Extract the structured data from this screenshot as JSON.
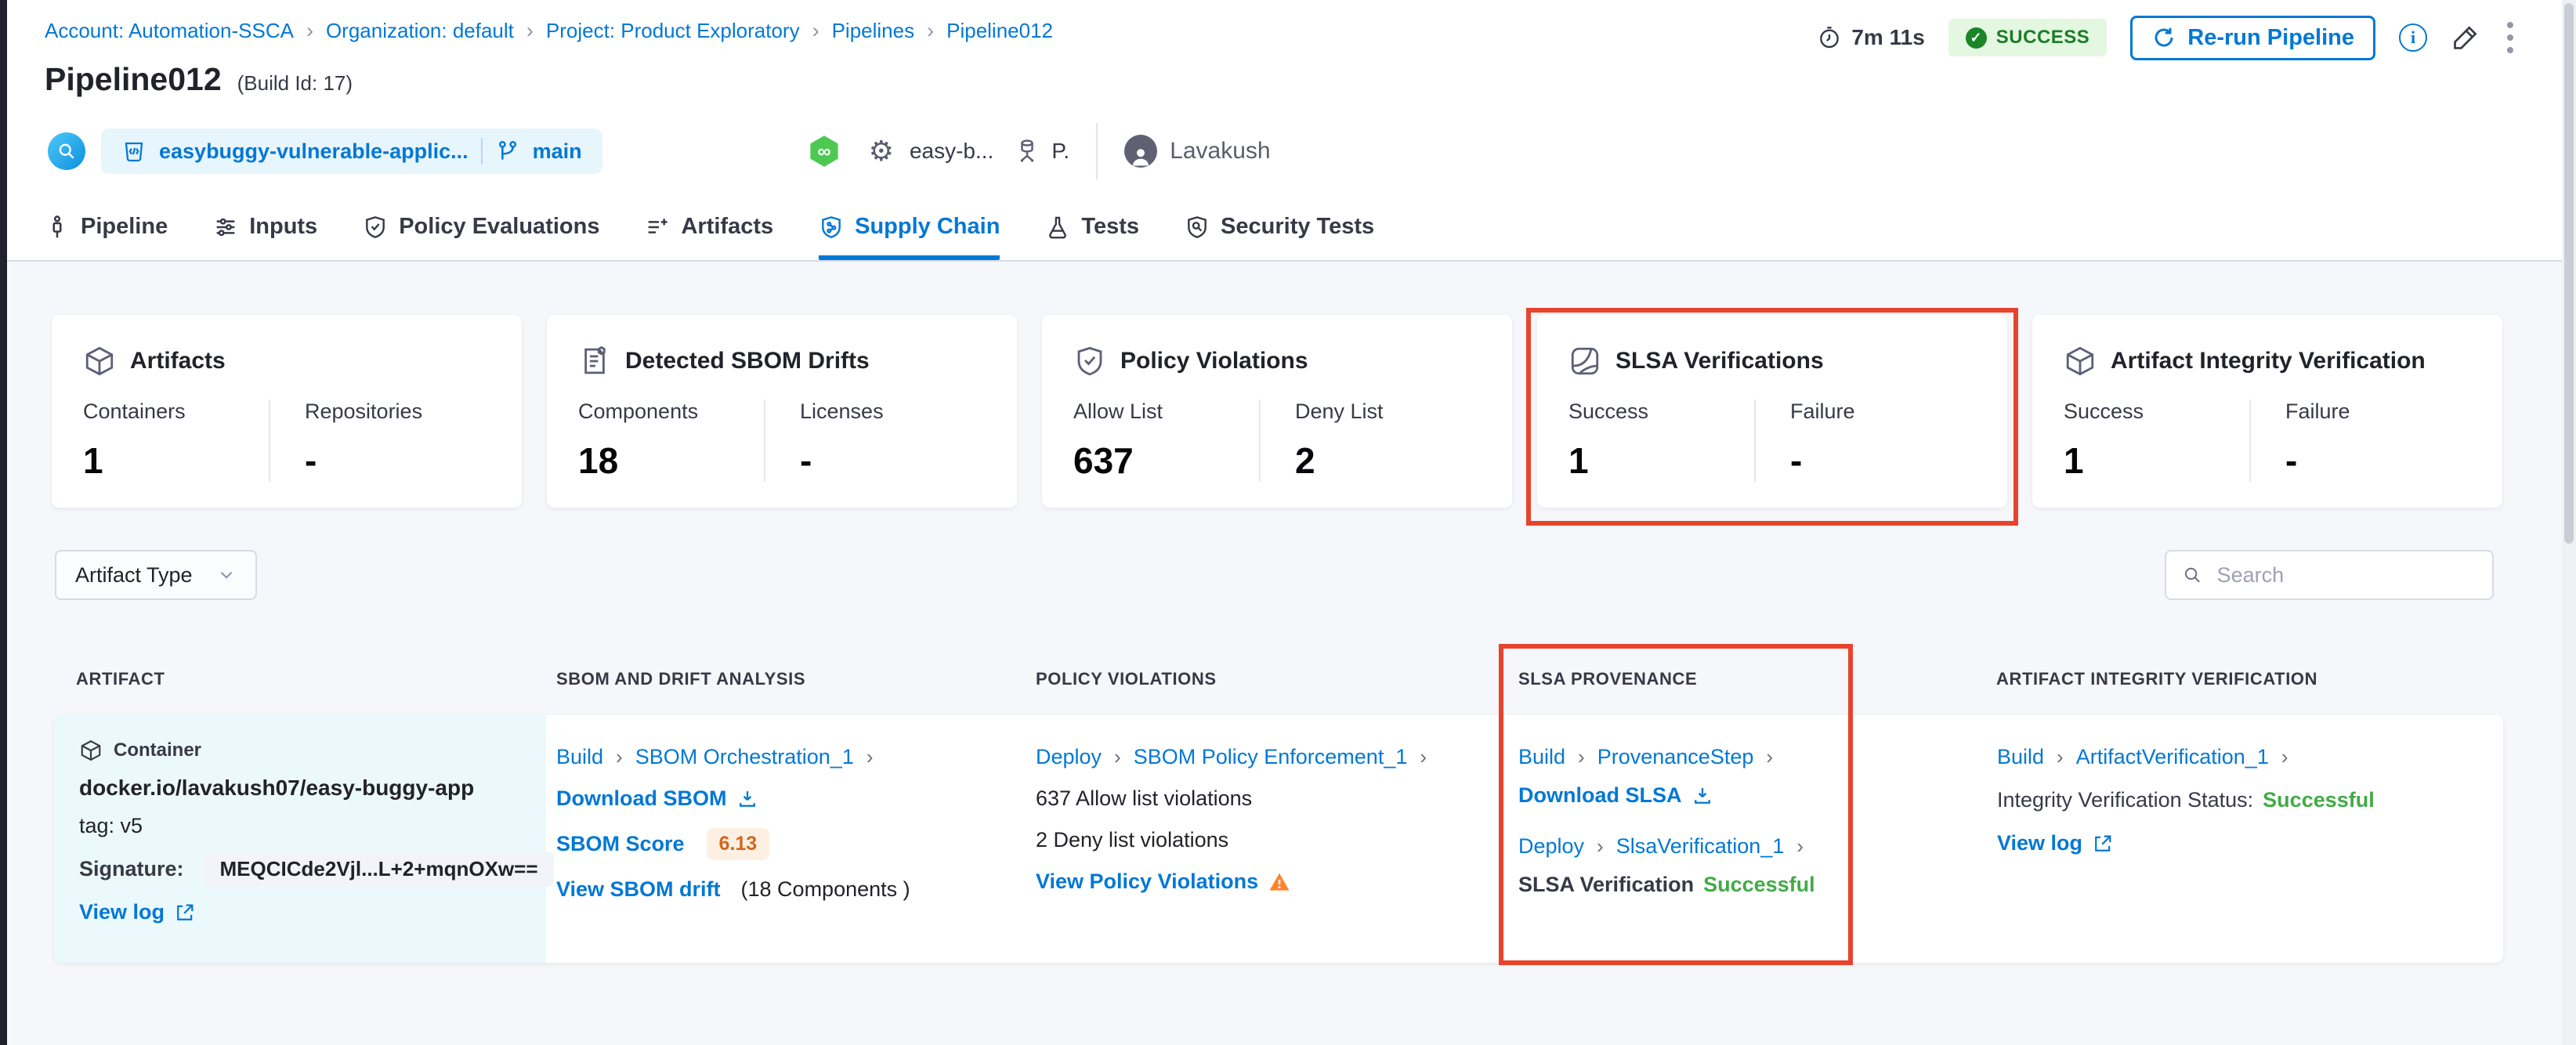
{
  "colors": {
    "accent": "#0278d5",
    "success": "#42ab45",
    "success-bg": "#e4f7e1",
    "success-text": "#1b7d29",
    "annotation": "#e8432c",
    "warn": "#ff832b",
    "score-text": "#d3661b",
    "score-bg": "#fdf0e3"
  },
  "breadcrumb": {
    "items": [
      "Account: Automation-SSCA",
      "Organization: default",
      "Project: Product Exploratory",
      "Pipelines",
      "Pipeline012"
    ]
  },
  "header": {
    "title": "Pipeline012",
    "build_id": "(Build Id: 17)",
    "duration": "7m 11s",
    "status_badge": "SUCCESS",
    "rerun_button": "Re-run Pipeline",
    "repo_name": "easybuggy-vulnerable-applic...",
    "branch": "main",
    "service_name": "easy-b...",
    "env_abbrev": "P.",
    "user_name": "Lavakush"
  },
  "tabs": [
    {
      "label": "Pipeline"
    },
    {
      "label": "Inputs"
    },
    {
      "label": "Policy Evaluations"
    },
    {
      "label": "Artifacts"
    },
    {
      "label": "Supply Chain",
      "active": true
    },
    {
      "label": "Tests"
    },
    {
      "label": "Security Tests"
    }
  ],
  "summary_cards": [
    {
      "icon": "cube-icon",
      "title": "Artifacts",
      "metrics": [
        {
          "label": "Containers",
          "value": "1"
        },
        {
          "label": "Repositories",
          "value": "-"
        }
      ]
    },
    {
      "icon": "sbom-document-icon",
      "title": "Detected SBOM Drifts",
      "metrics": [
        {
          "label": "Components",
          "value": "18"
        },
        {
          "label": "Licenses",
          "value": "-"
        }
      ]
    },
    {
      "icon": "shield-check-icon",
      "title": "Policy Violations",
      "metrics": [
        {
          "label": "Allow List",
          "value": "637"
        },
        {
          "label": "Deny List",
          "value": "2"
        }
      ]
    },
    {
      "icon": "slsa-icon",
      "title": "SLSA Verifications",
      "highlighted": true,
      "metrics": [
        {
          "label": "Success",
          "value": "1"
        },
        {
          "label": "Failure",
          "value": "-"
        }
      ]
    },
    {
      "icon": "cube-icon",
      "title": "Artifact Integrity Verification",
      "metrics": [
        {
          "label": "Success",
          "value": "1"
        },
        {
          "label": "Failure",
          "value": "-"
        }
      ]
    }
  ],
  "filters": {
    "artifact_type": "Artifact Type",
    "search_placeholder": "Search"
  },
  "table": {
    "columns": [
      "ARTIFACT",
      "SBOM AND DRIFT ANALYSIS",
      "POLICY VIOLATIONS",
      "SLSA PROVENANCE",
      "ARTIFACT INTEGRITY VERIFICATION"
    ],
    "row": {
      "artifact": {
        "type_label": "Container",
        "image": "docker.io/lavakush07/easy-buggy-app",
        "tag": "tag: v5",
        "signature_label": "Signature:",
        "signature": "MEQCICde2Vjl...L+2+mqnOXw==",
        "view_log": "View log"
      },
      "sbom": {
        "stage": "Build",
        "step": "SBOM Orchestration_1",
        "download": "Download SBOM",
        "score_label": "SBOM Score",
        "score": "6.13",
        "drift_link": "View SBOM drift",
        "drift_info": "(18 Components )"
      },
      "policy": {
        "stage": "Deploy",
        "step": "SBOM Policy Enforcement_1",
        "allow": "637 Allow list violations",
        "deny": "2 Deny list violations",
        "view": "View Policy Violations"
      },
      "slsa": {
        "stage1": "Build",
        "step1": "ProvenanceStep",
        "download": "Download SLSA",
        "stage2": "Deploy",
        "step2": "SlsaVerification_1",
        "status_label": "SLSA Verification",
        "status_value": "Successful"
      },
      "integrity": {
        "stage": "Build",
        "step": "ArtifactVerification_1",
        "status_label": "Integrity Verification Status:",
        "status_value": "Successful",
        "view_log": "View log"
      }
    }
  }
}
